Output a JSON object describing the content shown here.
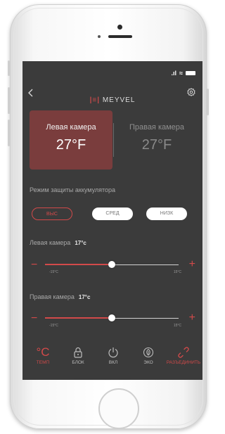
{
  "status": {
    "signal": ".ıl",
    "wifi": "≈"
  },
  "header": {
    "brand": "MEYVEL",
    "brand_mark": "|≡|"
  },
  "cameras": {
    "left": {
      "label": "Левая камера",
      "temp": "27°F",
      "active": true
    },
    "right": {
      "label": "Правая камера",
      "temp": "27°F",
      "active": false
    }
  },
  "battery": {
    "title": "Режим защиты аккумулятора",
    "options": [
      "ВЫС",
      "СРЕД",
      "НИЗК"
    ],
    "selected": "ВЫС"
  },
  "left_slider": {
    "label": "Левая камера",
    "value_text": "17°с",
    "min_label": "-15°C",
    "max_label": "15°C",
    "fraction": 0.5
  },
  "right_slider": {
    "label": "Правая камера",
    "value_text": "17°с",
    "min_label": "-15°C",
    "max_label": "15°C",
    "fraction": 0.5
  },
  "nav": [
    {
      "label": "ТЕМП",
      "icon": "thermometer-celsius-icon",
      "glyph": "°C",
      "state": "active"
    },
    {
      "label": "БЛОК",
      "icon": "lock-icon",
      "state": "normal"
    },
    {
      "label": "ВКЛ",
      "icon": "power-icon",
      "state": "normal"
    },
    {
      "label": "ЭКО",
      "icon": "leaf-icon",
      "state": "normal"
    },
    {
      "label": "РАЗЪЕДИНИТЬ",
      "icon": "unlink-icon",
      "state": "danger"
    }
  ],
  "colors": {
    "accent": "#d24a4a",
    "screen_bg": "#3b3b3b",
    "active_card": "#7a3d3d"
  }
}
